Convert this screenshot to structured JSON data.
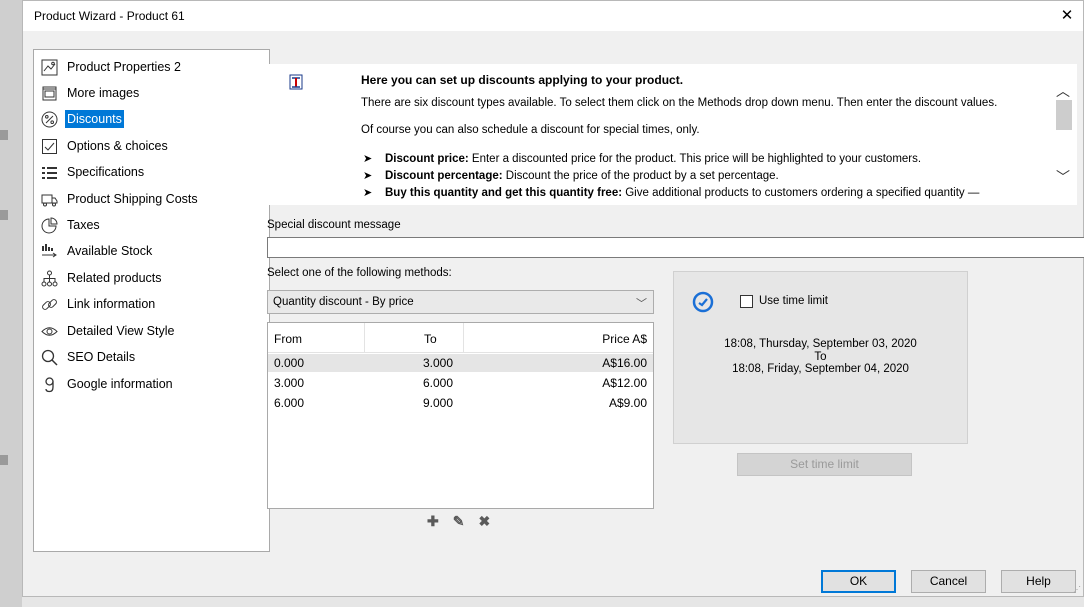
{
  "window": {
    "title": "Product Wizard - Product 61",
    "close_glyph": "✕"
  },
  "sidebar": {
    "items": [
      {
        "label": "Product Properties 2",
        "icon": "image-icon"
      },
      {
        "label": "More images",
        "icon": "images-icon"
      },
      {
        "label": "Discounts",
        "icon": "percent-icon",
        "active": true
      },
      {
        "label": "Options & choices",
        "icon": "checkbox-icon"
      },
      {
        "label": "Specifications",
        "icon": "list-icon"
      },
      {
        "label": "Product Shipping Costs",
        "icon": "truck-icon"
      },
      {
        "label": "Taxes",
        "icon": "pie-chart-icon"
      },
      {
        "label": "Available Stock",
        "icon": "stock-icon"
      },
      {
        "label": "Related products",
        "icon": "hierarchy-icon"
      },
      {
        "label": "Link information",
        "icon": "link-icon"
      },
      {
        "label": "Detailed View Style",
        "icon": "eye-icon"
      },
      {
        "label": "SEO Details",
        "icon": "search-icon"
      },
      {
        "label": "Google information",
        "icon": "google-g-icon"
      }
    ]
  },
  "info": {
    "heading": "Here you can set up discounts applying to your product.",
    "line1": "There are six discount types available. To select them click on the Methods drop down menu. Then enter the discount values.",
    "line2": "Of course you can also schedule a discount for special times, only.",
    "bullets": [
      {
        "title": "Discount price:",
        "text": " Enter a discounted price for the product. This price will be highlighted to your customers."
      },
      {
        "title": "Discount percentage:",
        "text": " Discount the price of the product by a set percentage."
      },
      {
        "title": "Buy this quantity and get this quantity free:",
        "text": " Give additional products to customers ordering a specified quantity —"
      }
    ]
  },
  "discount_message": {
    "label": "Special discount message",
    "value": ""
  },
  "method": {
    "label": "Select one of the following methods:",
    "selected": "Quantity discount - By price"
  },
  "table": {
    "headers": [
      "From",
      "To",
      "Price A$"
    ],
    "rows": [
      [
        "0.000",
        "3.000",
        "A$16.00"
      ],
      [
        "3.000",
        "6.000",
        "A$12.00"
      ],
      [
        "6.000",
        "9.000",
        "A$9.00"
      ]
    ],
    "selected_row": 0
  },
  "table_tools": {
    "add": "✚",
    "edit": "✎",
    "delete": "✖"
  },
  "time_limit": {
    "checkbox_label": "Use time limit",
    "checked": false,
    "start": "18:08, Thursday, September 03, 2020",
    "to": "To",
    "end": "18:08, Friday, September 04, 2020",
    "button": "Set time limit"
  },
  "buttons": {
    "ok": "OK",
    "cancel": "Cancel",
    "help": "Help"
  },
  "colors": {
    "accent": "#0078d7",
    "clock": "#1a6fd6"
  }
}
